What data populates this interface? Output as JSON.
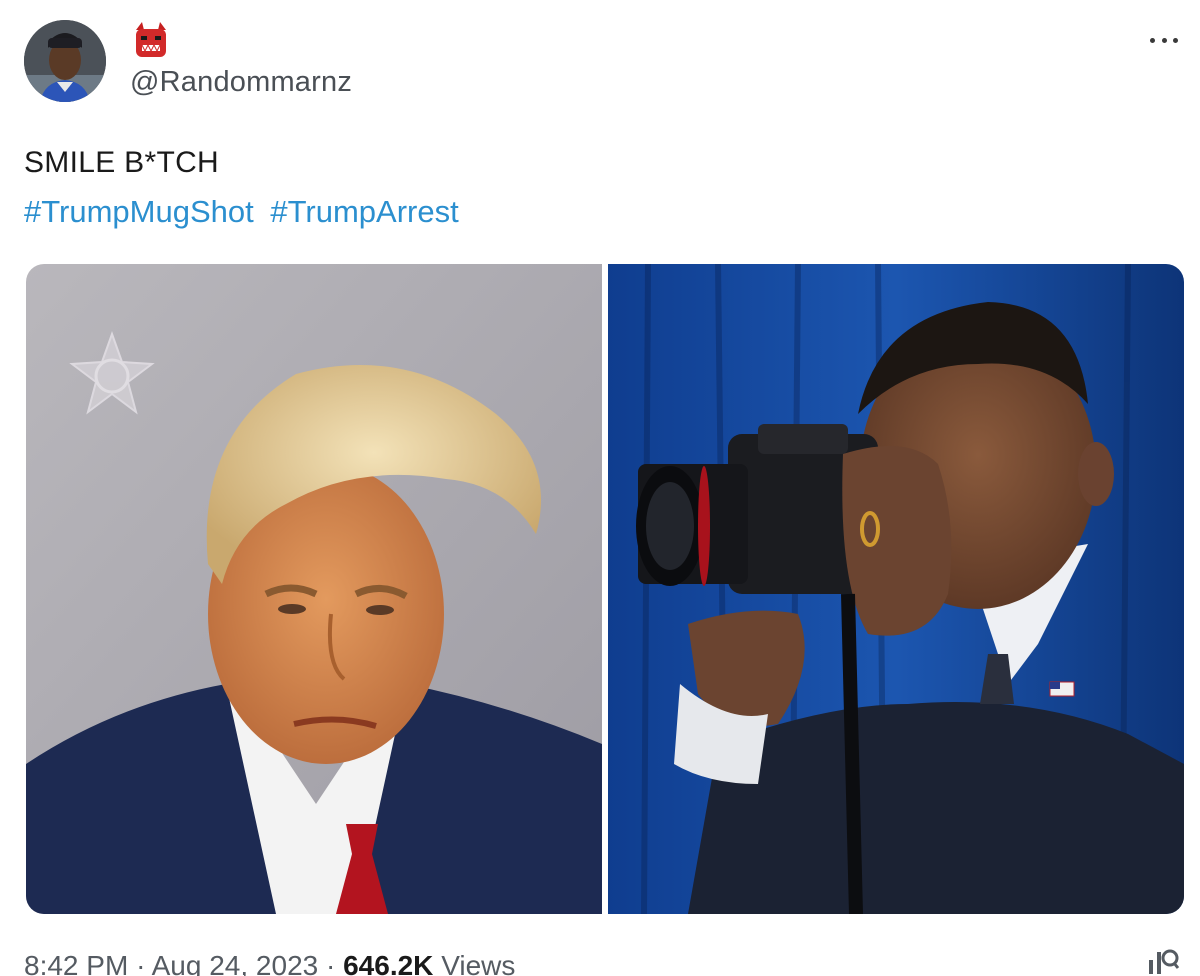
{
  "author": {
    "handle": "@Randommarnz",
    "avatar_icon": "profile-photo",
    "name_badge_icon": "red-emoji-badge"
  },
  "menu_icon": "more-horizontal-icon",
  "text": "SMILE B*TCH",
  "hashtags": [
    "#TrumpMugShot",
    "#TrumpArrest"
  ],
  "media": {
    "left_image": "mugshot-photo",
    "right_image": "camera-photographer-photo"
  },
  "meta": {
    "time": "8:42 PM",
    "date": "Aug 24, 2023",
    "views_count": "646.2K",
    "views_label": "Views",
    "separator": "·"
  },
  "analytics_icon": "analytics-icon",
  "colors": {
    "link": "#2b8fcf",
    "text": "#1a1a1a",
    "muted": "#555b62"
  }
}
